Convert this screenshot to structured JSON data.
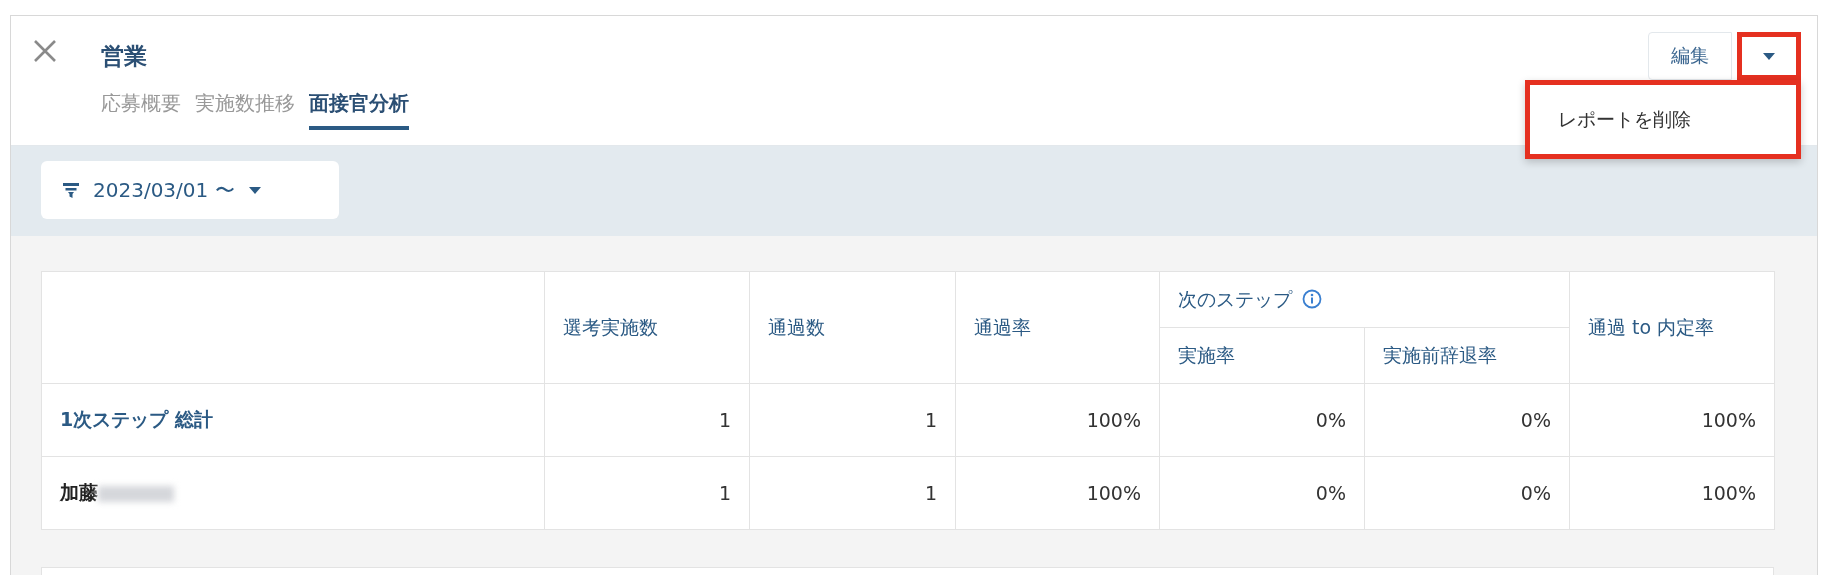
{
  "title": "営業",
  "tabs": [
    {
      "label": "応募概要",
      "selected": false
    },
    {
      "label": "実施数推移",
      "selected": false
    },
    {
      "label": "面接官分析",
      "selected": true
    }
  ],
  "edit_button": {
    "label": "編集"
  },
  "menu": {
    "expanded": true,
    "items": [
      {
        "label": "レポートを削除"
      }
    ]
  },
  "filter": {
    "label": "2023/03/01 〜"
  },
  "table": {
    "columns": [
      {
        "label": "選考実施数"
      },
      {
        "label": "通過数"
      },
      {
        "label": "通過率"
      },
      {
        "label": "次のステップ",
        "colspan": 2,
        "children": [
          {
            "label": "実施率"
          },
          {
            "label": "実施前辞退率"
          }
        ]
      },
      {
        "label": "通過 to 内定率"
      }
    ],
    "rows": [
      {
        "kind": "total",
        "label": "1次ステップ 総計",
        "cells": [
          "1",
          "1",
          "100%",
          "0%",
          "0%",
          "100%"
        ]
      },
      {
        "kind": "person",
        "label": "加藤",
        "cells": [
          "1",
          "1",
          "100%",
          "0%",
          "0%",
          "100%"
        ]
      }
    ]
  }
}
